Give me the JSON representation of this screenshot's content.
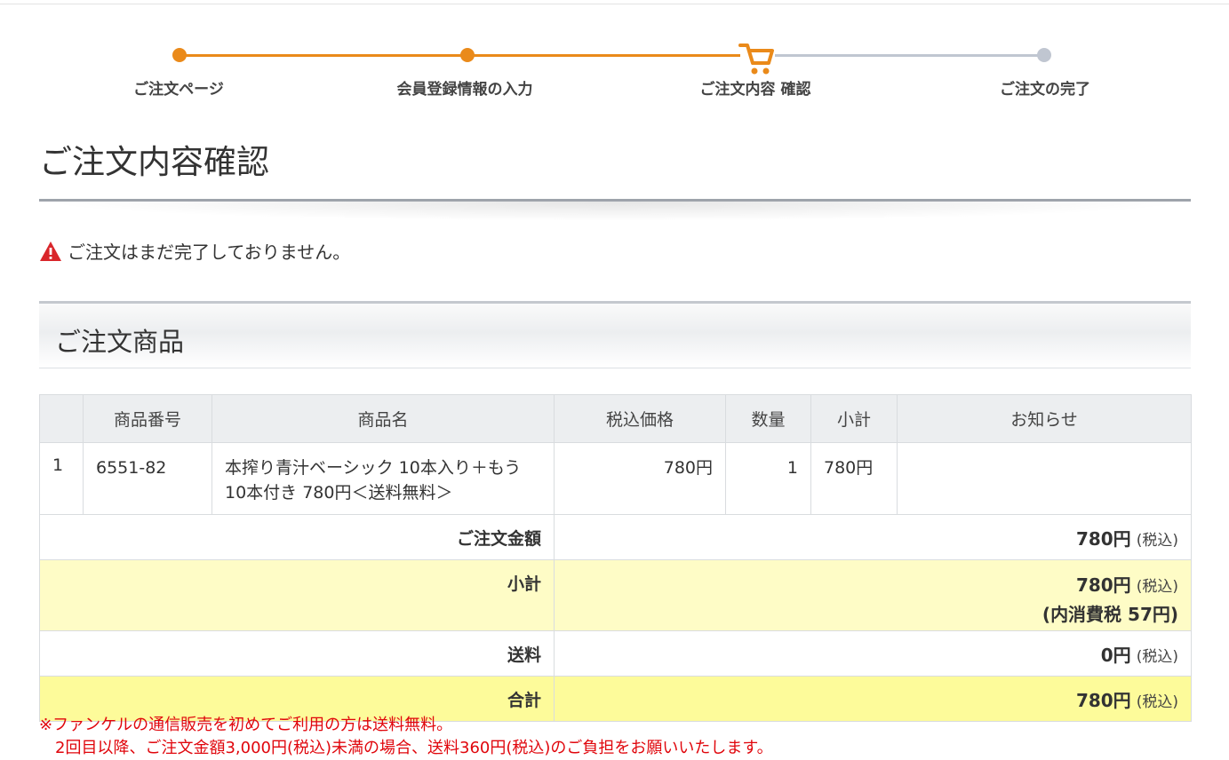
{
  "steps": [
    {
      "label": "ご注文ページ",
      "state": "done"
    },
    {
      "label": "会員登録情報の入力",
      "state": "done"
    },
    {
      "label": "ご注文内容 確認",
      "state": "current",
      "icon": "cart-icon"
    },
    {
      "label": "ご注文の完了",
      "state": "pending"
    }
  ],
  "colors": {
    "accent": "#ea8a1a",
    "inactive": "#c0c6d1",
    "warning": "#e0060c"
  },
  "page_title": "ご注文内容確認",
  "warning_text": "ご注文はまだ完了しておりません。",
  "section_title": "ご注文商品",
  "table": {
    "headers": [
      "",
      "商品番号",
      "商品名",
      "税込価格",
      "数量",
      "小計",
      "お知らせ"
    ],
    "row": {
      "index": "1",
      "code": "6551-82",
      "name": "本搾り青汁ベーシック 10本入り＋もう10本付き 780円＜送料無料＞",
      "price": "780円",
      "qty": "1",
      "subtotal": "780円",
      "notice": ""
    }
  },
  "summary": {
    "order_amount_label": "ご注文金額",
    "order_amount": "780円",
    "subtotal_label": "小計",
    "subtotal": "780円",
    "tax_included": "(内消費税 57円)",
    "shipping_label": "送料",
    "shipping": "0円",
    "total_label": "合計",
    "total": "780円",
    "tax_suffix": "(税込)"
  },
  "notes": [
    "※ファンケルの通信販売を初めてご利用の方は送料無料。",
    "2回目以降、ご注文金額3,000円(税込)未満の場合、送料360円(税込)のご負担をお願いいたします。"
  ]
}
